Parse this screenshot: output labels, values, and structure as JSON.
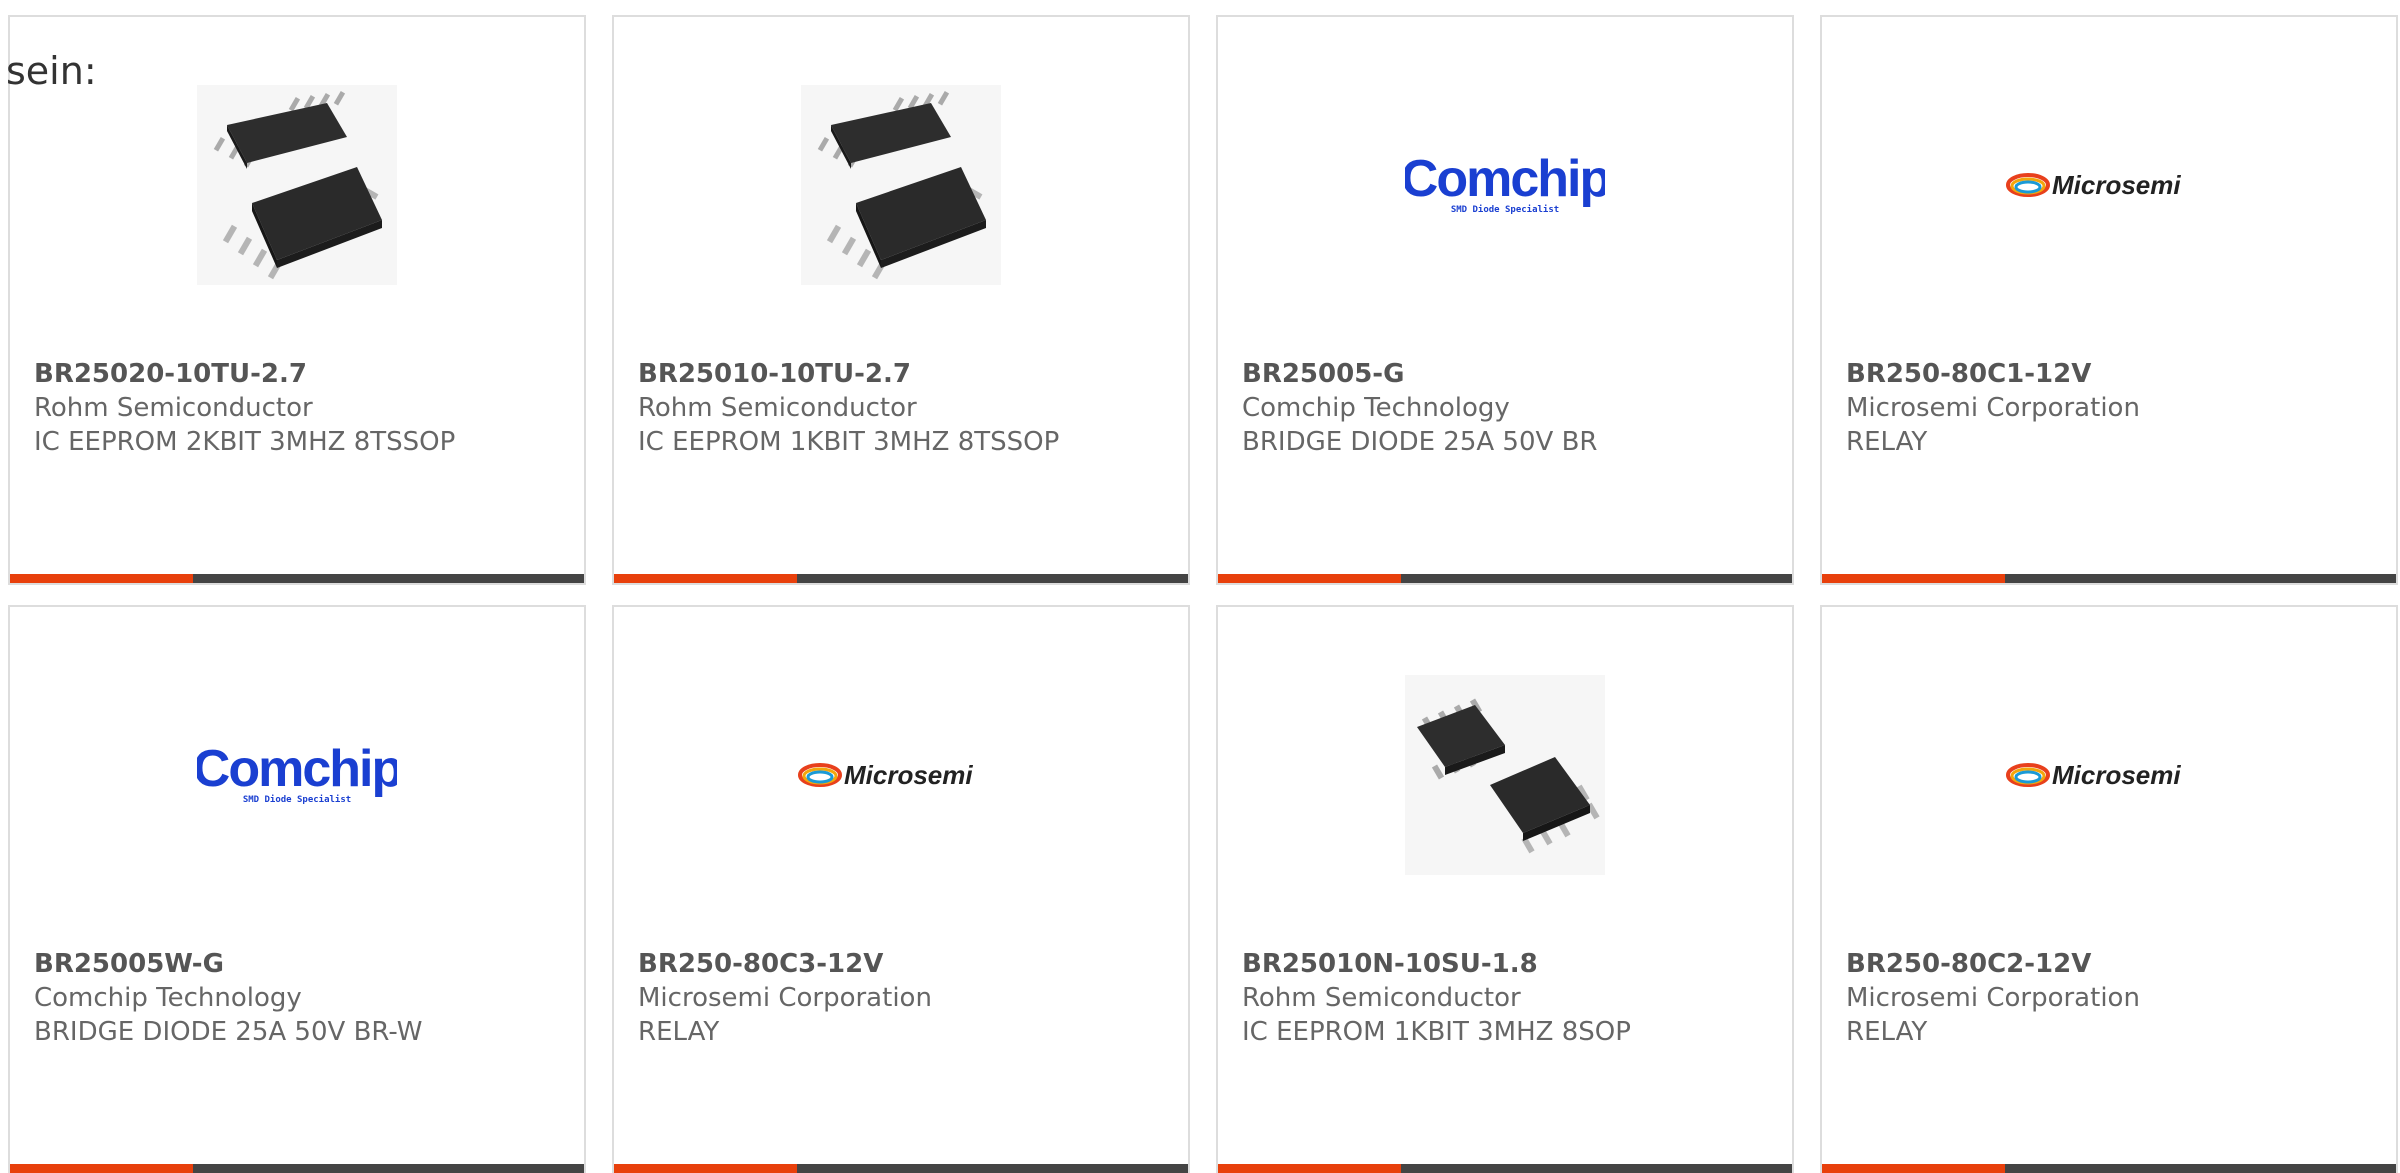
{
  "intro_text": "sein:",
  "colors": {
    "accent": "#e8400c",
    "bar_dark": "#444444",
    "border": "#dddddd",
    "text": "#666666",
    "comchip_blue": "#1a3fd1",
    "microsemi_text": "#222222"
  },
  "products": [
    {
      "part_number": "BR25020-10TU-2.7",
      "manufacturer": "Rohm Semiconductor",
      "description": "IC EEPROM 2KBIT 3MHZ 8TSSOP",
      "image": "tssop-chip-photo"
    },
    {
      "part_number": "BR25010-10TU-2.7",
      "manufacturer": "Rohm Semiconductor",
      "description": "IC EEPROM 1KBIT 3MHZ 8TSSOP",
      "image": "tssop-chip-photo"
    },
    {
      "part_number": "BR25005-G",
      "manufacturer": "Comchip Technology",
      "description": "BRIDGE DIODE 25A 50V BR",
      "image": "comchip-logo"
    },
    {
      "part_number": "BR250-80C1-12V",
      "manufacturer": "Microsemi Corporation",
      "description": "RELAY",
      "image": "microsemi-logo"
    },
    {
      "part_number": "BR25005W-G",
      "manufacturer": "Comchip Technology",
      "description": "BRIDGE DIODE 25A 50V BR-W",
      "image": "comchip-logo"
    },
    {
      "part_number": "BR250-80C3-12V",
      "manufacturer": "Microsemi Corporation",
      "description": "RELAY",
      "image": "microsemi-logo"
    },
    {
      "part_number": "BR25010N-10SU-1.8",
      "manufacturer": "Rohm Semiconductor",
      "description": "IC EEPROM 1KBIT 3MHZ 8SOP",
      "image": "sop-chip-photo"
    },
    {
      "part_number": "BR250-80C2-12V",
      "manufacturer": "Microsemi Corporation",
      "description": "RELAY",
      "image": "microsemi-logo"
    }
  ],
  "logos": {
    "comchip_name": "Comchip",
    "comchip_tagline": "SMD Diode Specialist",
    "microsemi_name": "Microsemi"
  }
}
